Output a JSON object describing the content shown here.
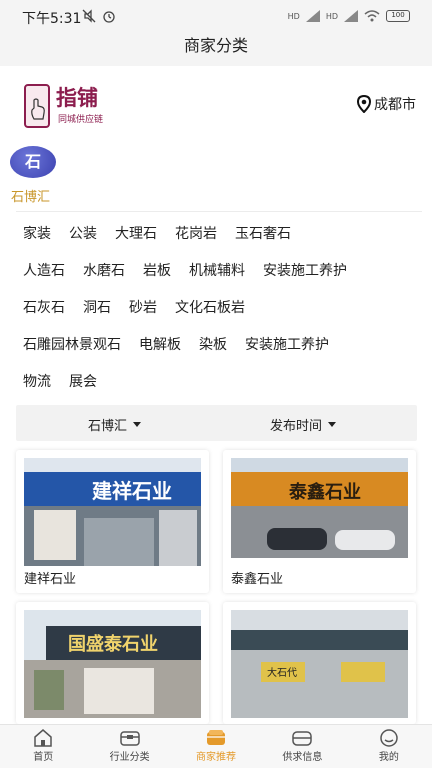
{
  "status": {
    "time": "下午5:31",
    "battery": "100",
    "signal1": "HD",
    "signal2": "HD"
  },
  "nav": {
    "title": "商家分类"
  },
  "logo": {
    "title": "指铺",
    "subtitle": "同城供应链"
  },
  "location": {
    "city": "成都市"
  },
  "brand": {
    "badge": "石",
    "name": "石博汇"
  },
  "categories": [
    [
      "家装",
      "公装",
      "大理石",
      "花岗岩",
      "玉石奢石"
    ],
    [
      "人造石",
      "水磨石",
      "岩板",
      "机械辅料",
      "安装施工养护"
    ],
    [
      "石灰石",
      "洞石",
      "砂岩",
      "文化石板岩"
    ],
    [
      "石雕园林景观石",
      "电解板",
      "染板",
      "安装施工养护"
    ],
    [
      "物流",
      "展会"
    ]
  ],
  "filters": {
    "left": "石博汇",
    "right": "发布时间"
  },
  "cards": [
    {
      "title": "建祥石业",
      "sign": "建祥石业"
    },
    {
      "title": "泰鑫石业",
      "sign": "泰鑫石业"
    },
    {
      "title": "国盛泰石业",
      "sign": "国盛泰石业"
    },
    {
      "title": "大石代",
      "sign": "大石代"
    }
  ],
  "tabs": [
    "首页",
    "行业分类",
    "商家推荐",
    "供求信息",
    "我的"
  ],
  "colors": {
    "accent": "#e49a2b",
    "brand_gold": "#c8962a",
    "badge_blue": "#4a50c0",
    "logo": "#8c1d4e"
  }
}
